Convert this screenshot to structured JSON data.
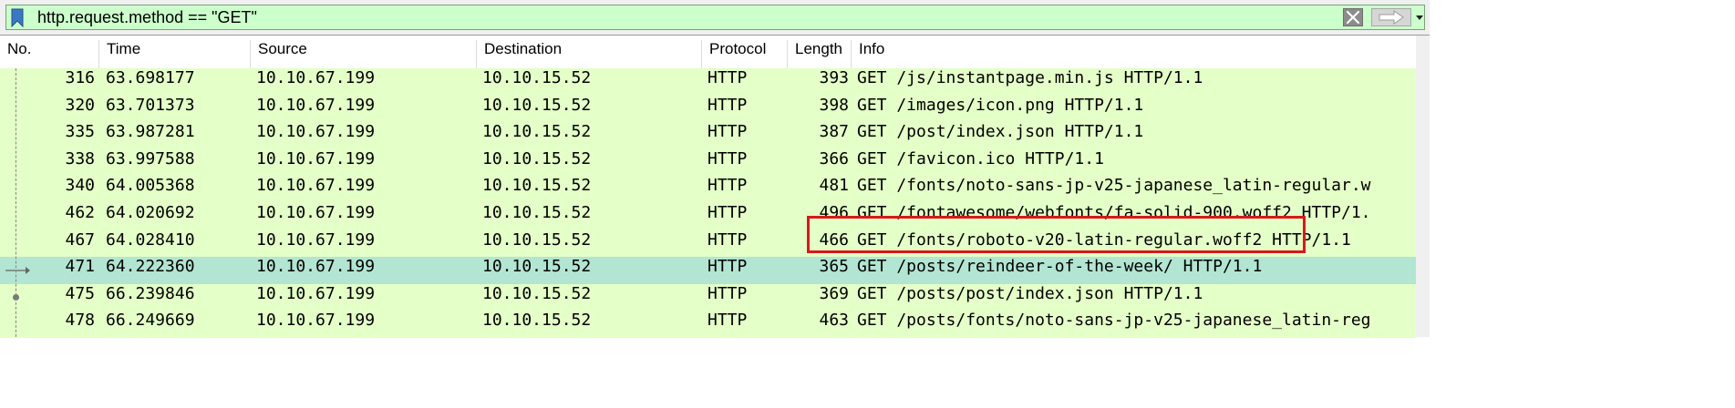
{
  "filter": {
    "value": "http.request.method == \"GET\"",
    "background": "#ccffcc"
  },
  "icons": {
    "bookmark": "bookmark-icon",
    "clear": "clear-x-icon",
    "apply": "right-arrow-icon",
    "dropdown": "chevron-down-icon"
  },
  "columns": [
    "No.",
    "Time",
    "Source",
    "Destination",
    "Protocol",
    "Length",
    "Info"
  ],
  "rows": [
    {
      "no": "316",
      "time": "63.698177",
      "source": "10.10.67.199",
      "destination": "10.10.15.52",
      "protocol": "HTTP",
      "length": "393",
      "info": "GET /js/instantpage.min.js HTTP/1.1"
    },
    {
      "no": "320",
      "time": "63.701373",
      "source": "10.10.67.199",
      "destination": "10.10.15.52",
      "protocol": "HTTP",
      "length": "398",
      "info": "GET /images/icon.png HTTP/1.1"
    },
    {
      "no": "335",
      "time": "63.987281",
      "source": "10.10.67.199",
      "destination": "10.10.15.52",
      "protocol": "HTTP",
      "length": "387",
      "info": "GET /post/index.json HTTP/1.1"
    },
    {
      "no": "338",
      "time": "63.997588",
      "source": "10.10.67.199",
      "destination": "10.10.15.52",
      "protocol": "HTTP",
      "length": "366",
      "info": "GET /favicon.ico HTTP/1.1"
    },
    {
      "no": "340",
      "time": "64.005368",
      "source": "10.10.67.199",
      "destination": "10.10.15.52",
      "protocol": "HTTP",
      "length": "481",
      "info": "GET /fonts/noto-sans-jp-v25-japanese_latin-regular.w"
    },
    {
      "no": "462",
      "time": "64.020692",
      "source": "10.10.67.199",
      "destination": "10.10.15.52",
      "protocol": "HTTP",
      "length": "496",
      "info": "GET /fontawesome/webfonts/fa-solid-900.woff2 HTTP/1."
    },
    {
      "no": "467",
      "time": "64.028410",
      "source": "10.10.67.199",
      "destination": "10.10.15.52",
      "protocol": "HTTP",
      "length": "466",
      "info": "GET /fonts/roboto-v20-latin-regular.woff2 HTTP/1.1"
    },
    {
      "no": "471",
      "time": "64.222360",
      "source": "10.10.67.199",
      "destination": "10.10.15.52",
      "protocol": "HTTP",
      "length": "365",
      "info": "GET /posts/reindeer-of-the-week/ HTTP/1.1",
      "selected": true
    },
    {
      "no": "475",
      "time": "66.239846",
      "source": "10.10.67.199",
      "destination": "10.10.15.52",
      "protocol": "HTTP",
      "length": "369",
      "info": "GET /posts/post/index.json HTTP/1.1"
    },
    {
      "no": "478",
      "time": "66.249669",
      "source": "10.10.67.199",
      "destination": "10.10.15.52",
      "protocol": "HTTP",
      "length": "463",
      "info": "GET /posts/fonts/noto-sans-jp-v25-japanese_latin-reg"
    }
  ],
  "colors": {
    "row_http": "#e4ffc7",
    "row_selected": "#b2e5d2",
    "highlight_box": "#d8191b"
  }
}
